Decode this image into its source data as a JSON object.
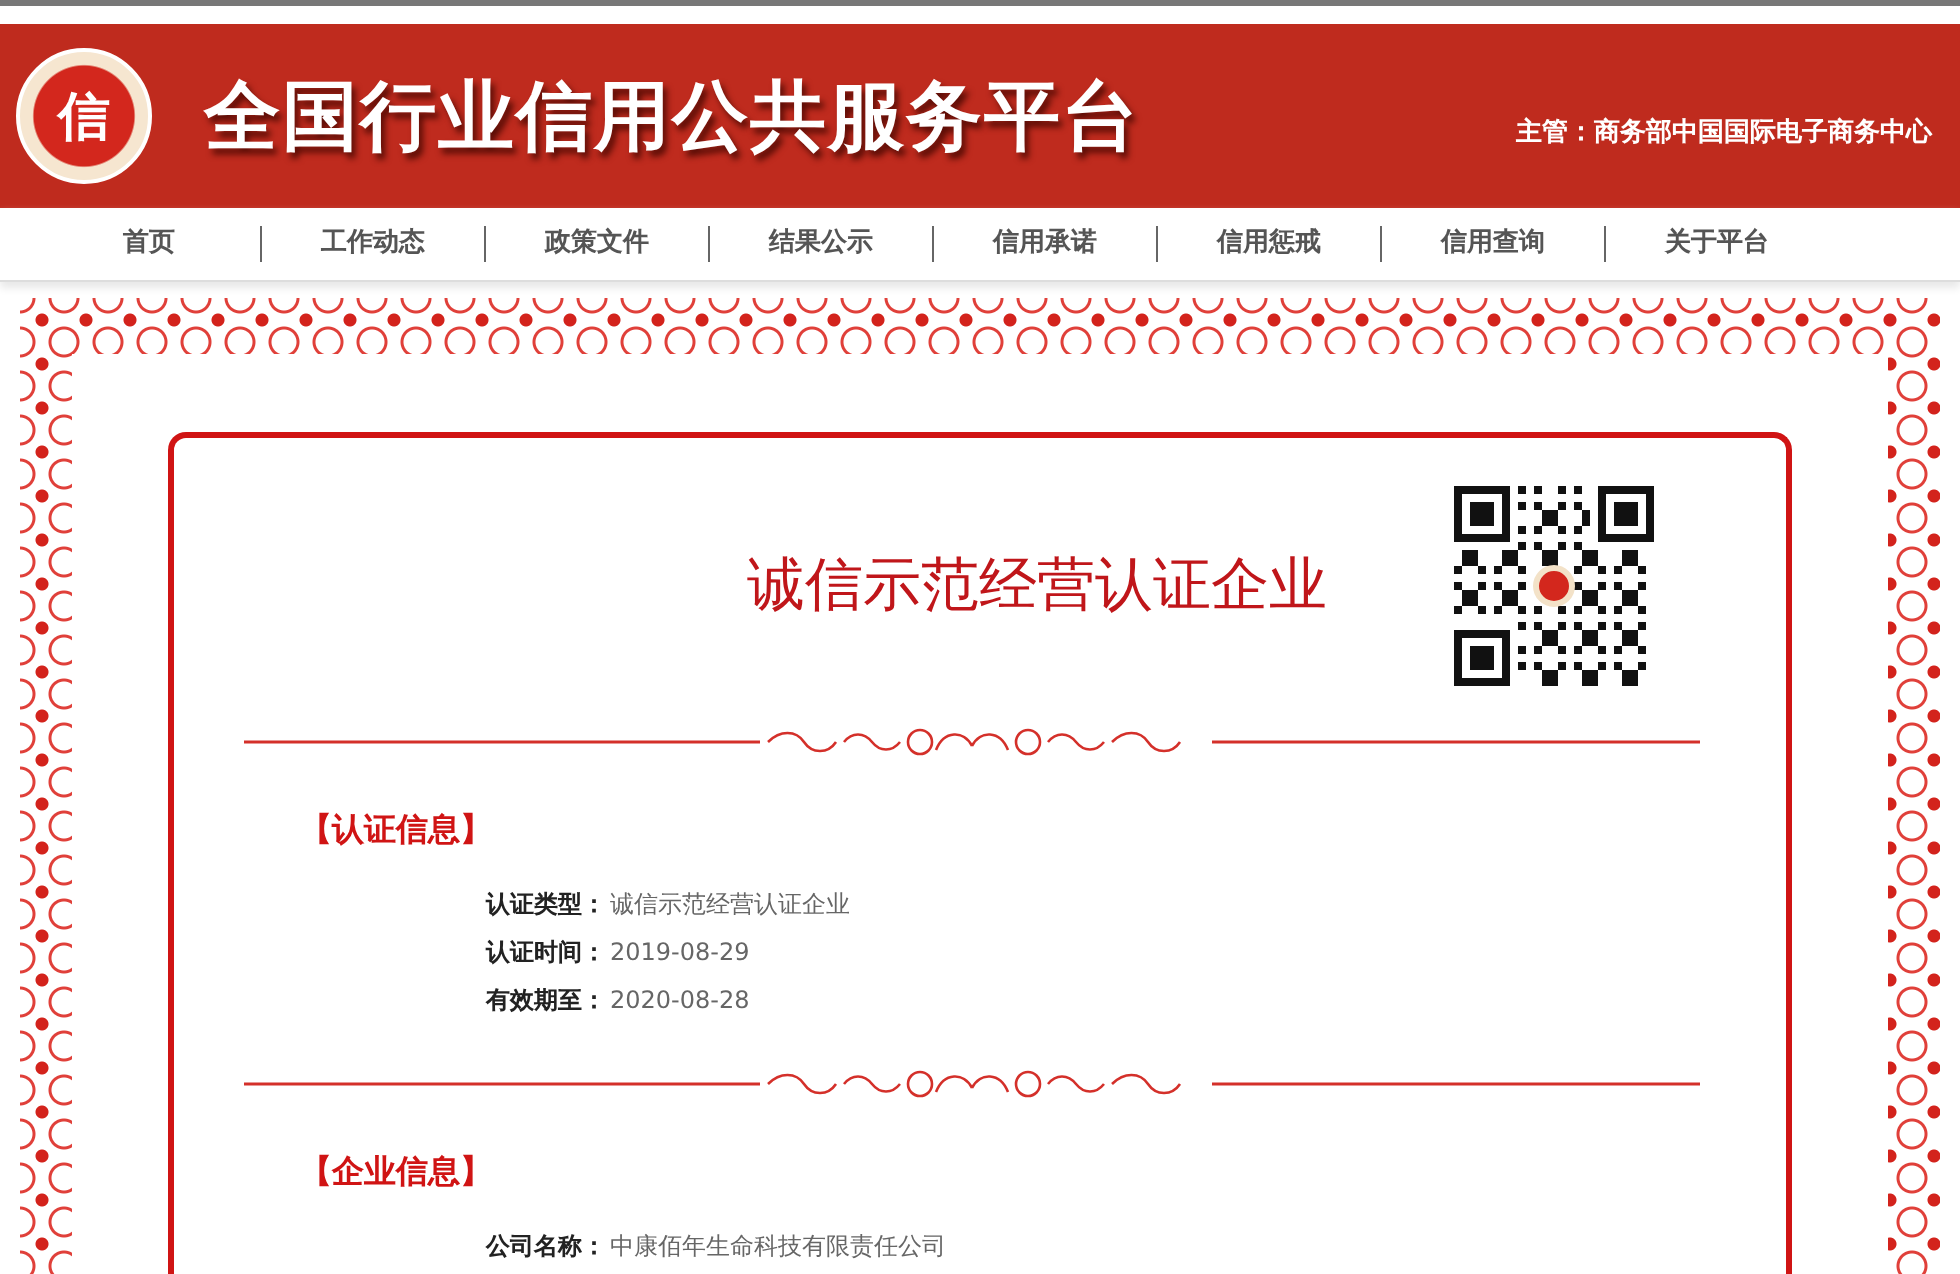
{
  "header": {
    "logo_mark": "信",
    "title": "全国行业信用公共服务平台",
    "supervisor": "主管：商务部中国国际电子商务中心"
  },
  "nav": [
    {
      "label": "首页"
    },
    {
      "label": "工作动态"
    },
    {
      "label": "政策文件"
    },
    {
      "label": "结果公示"
    },
    {
      "label": "信用承诺"
    },
    {
      "label": "信用惩戒"
    },
    {
      "label": "信用查询"
    },
    {
      "label": "关于平台"
    }
  ],
  "certificate": {
    "title": "诚信示范经营认证企业",
    "sections": [
      {
        "heading": "【认证信息】",
        "fields": [
          {
            "label": "认证类型：",
            "value": "诚信示范经营认证企业"
          },
          {
            "label": "认证时间：",
            "value": "2019-08-29"
          },
          {
            "label": "有效期至：",
            "value": "2020-08-28"
          }
        ]
      },
      {
        "heading": "【企业信息】",
        "fields": [
          {
            "label": "公司名称：",
            "value": "中康佰年生命科技有限责任公司"
          }
        ]
      }
    ]
  }
}
